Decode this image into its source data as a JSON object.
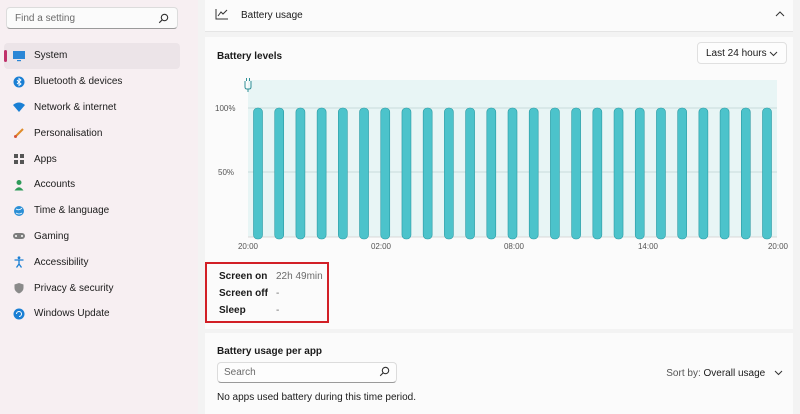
{
  "sidebar": {
    "search_placeholder": "Find a setting",
    "items": [
      {
        "label": "System",
        "icon": "display-icon",
        "active": true
      },
      {
        "label": "Bluetooth & devices",
        "icon": "bluetooth-icon"
      },
      {
        "label": "Network & internet",
        "icon": "wifi-icon"
      },
      {
        "label": "Personalisation",
        "icon": "brush-icon"
      },
      {
        "label": "Apps",
        "icon": "apps-icon"
      },
      {
        "label": "Accounts",
        "icon": "person-icon"
      },
      {
        "label": "Time & language",
        "icon": "globe-icon"
      },
      {
        "label": "Gaming",
        "icon": "controller-icon"
      },
      {
        "label": "Accessibility",
        "icon": "accessibility-icon"
      },
      {
        "label": "Privacy & security",
        "icon": "shield-icon"
      },
      {
        "label": "Windows Update",
        "icon": "update-icon"
      }
    ]
  },
  "usage": {
    "title": "Battery usage"
  },
  "levels": {
    "title": "Battery levels",
    "range": "Last 24 hours"
  },
  "chart_data": {
    "type": "bar",
    "y_ticks": [
      "100%",
      "50%"
    ],
    "x_ticks": [
      "20:00",
      "02:00",
      "08:00",
      "14:00",
      "20:00"
    ],
    "values": [
      100,
      100,
      100,
      100,
      100,
      100,
      100,
      100,
      100,
      100,
      100,
      100,
      100,
      100,
      100,
      100,
      100,
      100,
      100,
      100,
      100,
      100,
      100,
      100,
      100
    ],
    "ylim": [
      0,
      100
    ],
    "bar_color": "#4cc3cb",
    "band_color": "#e8f5f5"
  },
  "stats": {
    "screen_on_label": "Screen on",
    "screen_on_value": "22h 49min",
    "screen_off_label": "Screen off",
    "screen_off_value": "-",
    "sleep_label": "Sleep",
    "sleep_value": "-"
  },
  "apps": {
    "title": "Battery usage per app",
    "search_placeholder": "Search",
    "sort_label": "Sort by:",
    "sort_value": "Overall usage",
    "empty_message": "No apps used battery during this time period."
  },
  "colors": {
    "accent": "#c0316a",
    "highlight_box": "#d21f26"
  }
}
